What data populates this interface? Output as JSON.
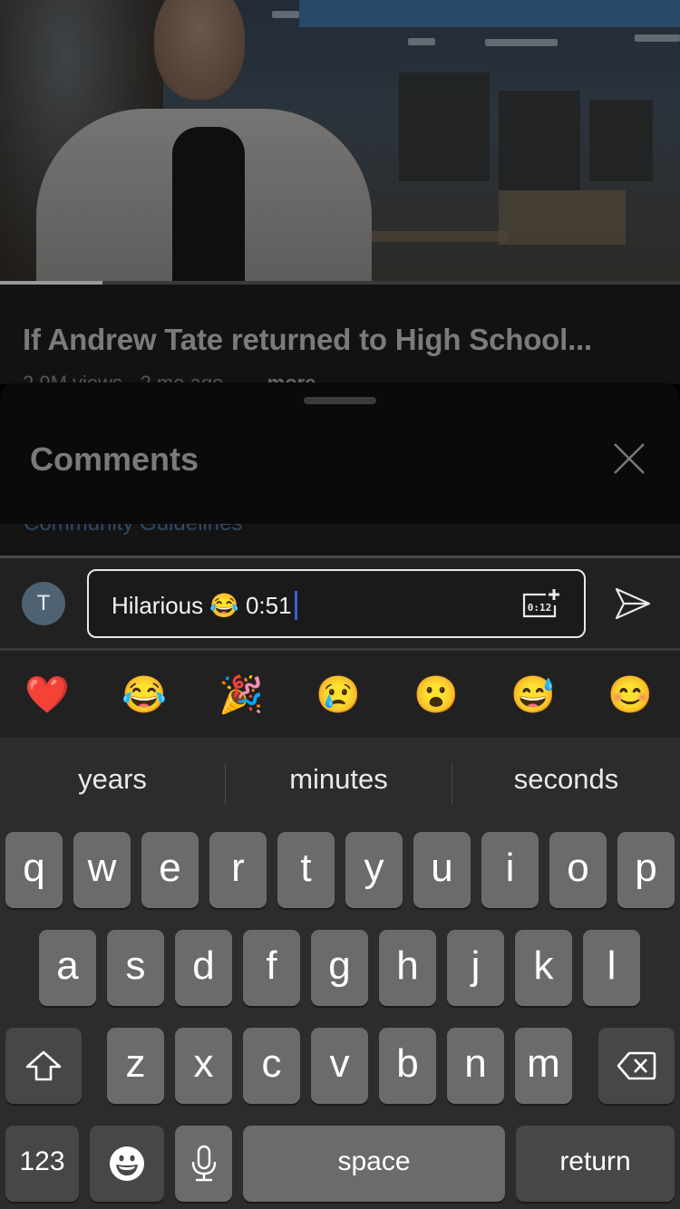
{
  "video": {
    "progress_fraction": 0.15
  },
  "video_info": {
    "title": "If Andrew Tate returned to High School...",
    "meta": "2.9M views · 2 mo ago",
    "more_label": "...more"
  },
  "comments_sheet": {
    "heading": "Comments",
    "guidelines_text": "Community Guidelines"
  },
  "composer": {
    "avatar_initial": "T",
    "input_value": "Hilarious 😂 0:51",
    "timestamp_icon_text": "0:12"
  },
  "emoji_bar": {
    "items": [
      {
        "name": "red-heart",
        "glyph": "❤️"
      },
      {
        "name": "tears-of-joy",
        "glyph": "😂"
      },
      {
        "name": "party-popper",
        "glyph": "🎉"
      },
      {
        "name": "crying-face",
        "glyph": "😢"
      },
      {
        "name": "surprised-face",
        "glyph": "😮"
      },
      {
        "name": "sweat-smile",
        "glyph": "😅"
      },
      {
        "name": "smiling-face",
        "glyph": "😊"
      }
    ]
  },
  "keyboard": {
    "suggestions": [
      "years",
      "minutes",
      "seconds"
    ],
    "row1": [
      "q",
      "w",
      "e",
      "r",
      "t",
      "y",
      "u",
      "i",
      "o",
      "p"
    ],
    "row2": [
      "a",
      "s",
      "d",
      "f",
      "g",
      "h",
      "j",
      "k",
      "l"
    ],
    "row3": [
      "z",
      "x",
      "c",
      "v",
      "b",
      "n",
      "m"
    ],
    "numbers_label": "123",
    "space_label": "space",
    "return_label": "return"
  },
  "colors": {
    "caret": "#3f5fd6",
    "avatar_bg": "#4e6272",
    "key_bg": "#6b6b6b",
    "fn_key_bg": "#474747",
    "keyboard_bg": "#2c2c2c"
  }
}
